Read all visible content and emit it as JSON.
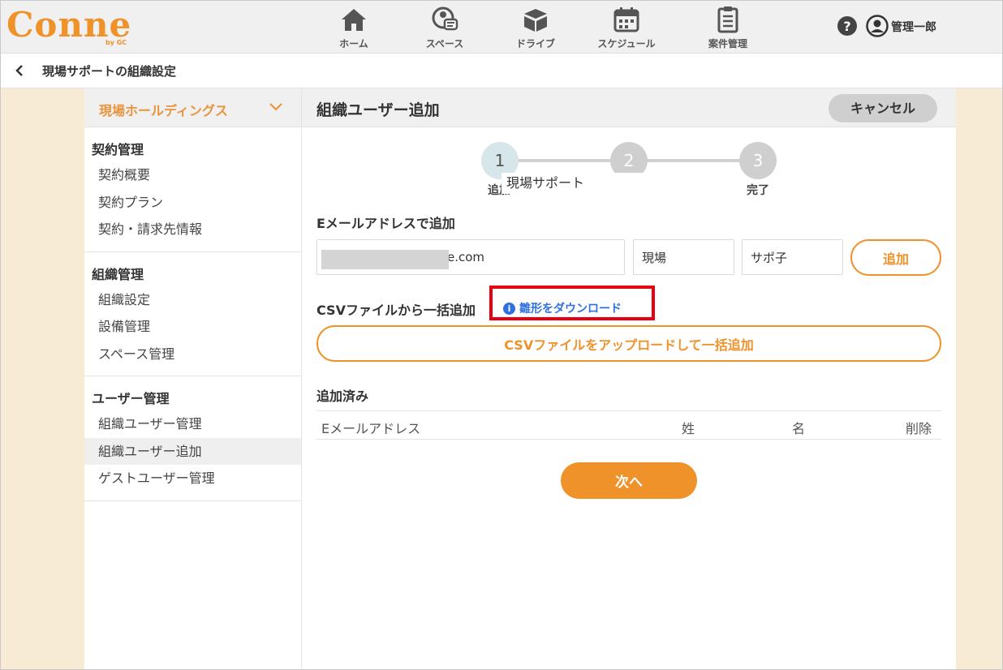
{
  "brand": {
    "logo": "Conne",
    "by": "by GC",
    "color": "#f0922a"
  },
  "nav": [
    {
      "label": "ホーム",
      "icon": "home-icon"
    },
    {
      "label": "スペース",
      "icon": "space-icon"
    },
    {
      "label": "ドライブ",
      "icon": "drive-icon"
    },
    {
      "label": "スケジュール",
      "icon": "calendar-icon"
    },
    {
      "label": "案件管理",
      "icon": "clipboard-icon"
    }
  ],
  "header": {
    "help": "?",
    "user_name": "管理一郎"
  },
  "breadcrumb": {
    "title": "現場サポートの組織設定"
  },
  "sidebar": {
    "org_name": "現場ホールディングス",
    "groups": [
      {
        "heading": "契約管理",
        "items": [
          "契約概要",
          "契約プラン",
          "契約・請求先情報"
        ]
      },
      {
        "heading": "組織管理",
        "items": [
          "組織設定",
          "設備管理",
          "スペース管理"
        ]
      },
      {
        "heading": "ユーザー管理",
        "items": [
          "組織ユーザー管理",
          "組織ユーザー追加",
          "ゲストユーザー管理"
        ]
      }
    ],
    "active_item": "組織ユーザー追加"
  },
  "main": {
    "title": "組織ユーザー追加",
    "cancel_label": "キャンセル",
    "steps": [
      {
        "number": "1",
        "label": "追加"
      },
      {
        "number": "2",
        "label": ""
      },
      {
        "number": "3",
        "label": "完了"
      }
    ],
    "tooltip": "現場サポート",
    "email_section_label": "Eメールアドレスで追加",
    "email_value": "e.com",
    "last_name_value": "現場",
    "first_name_value": "サポ子",
    "add_label": "追加",
    "csv_section_label": "CSVファイルから一括追加",
    "template_download_label": "雛形をダウンロード",
    "csv_upload_label": "CSVファイルをアップロードして一括追加",
    "added_section_label": "追加済み",
    "table_headers": {
      "email": "Eメールアドレス",
      "last_name": "姓",
      "first_name": "名",
      "delete": "削除"
    },
    "next_label": "次へ"
  },
  "colors": {
    "accent": "#f0922a",
    "link": "#2f6fe0",
    "highlight": "#e60012"
  }
}
